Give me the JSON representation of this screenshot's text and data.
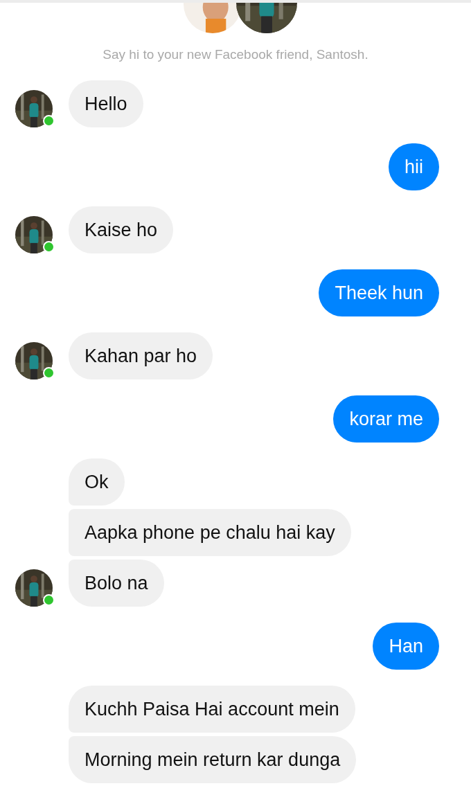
{
  "intro": {
    "text": "Say hi to your new Facebook friend, Santosh."
  },
  "groups": [
    {
      "kind": "incoming",
      "avatar": true,
      "online": true,
      "messages": [
        "Hello"
      ]
    },
    {
      "kind": "outgoing",
      "messages": [
        "hii"
      ]
    },
    {
      "kind": "incoming",
      "avatar": true,
      "online": true,
      "messages": [
        "Kaise ho"
      ]
    },
    {
      "kind": "outgoing",
      "messages": [
        "Theek hun"
      ]
    },
    {
      "kind": "incoming",
      "avatar": true,
      "online": true,
      "messages": [
        "Kahan par ho"
      ]
    },
    {
      "kind": "outgoing",
      "messages": [
        "korar me"
      ]
    },
    {
      "kind": "incoming",
      "avatar": true,
      "online": true,
      "messages": [
        "Ok",
        "Aapka phone pe chalu hai kay",
        "Bolo na"
      ]
    },
    {
      "kind": "outgoing",
      "messages": [
        "Han"
      ]
    },
    {
      "kind": "incoming",
      "messages": [
        "Kuchh Paisa Hai account mein",
        "Morning mein return kar dunga"
      ]
    }
  ]
}
